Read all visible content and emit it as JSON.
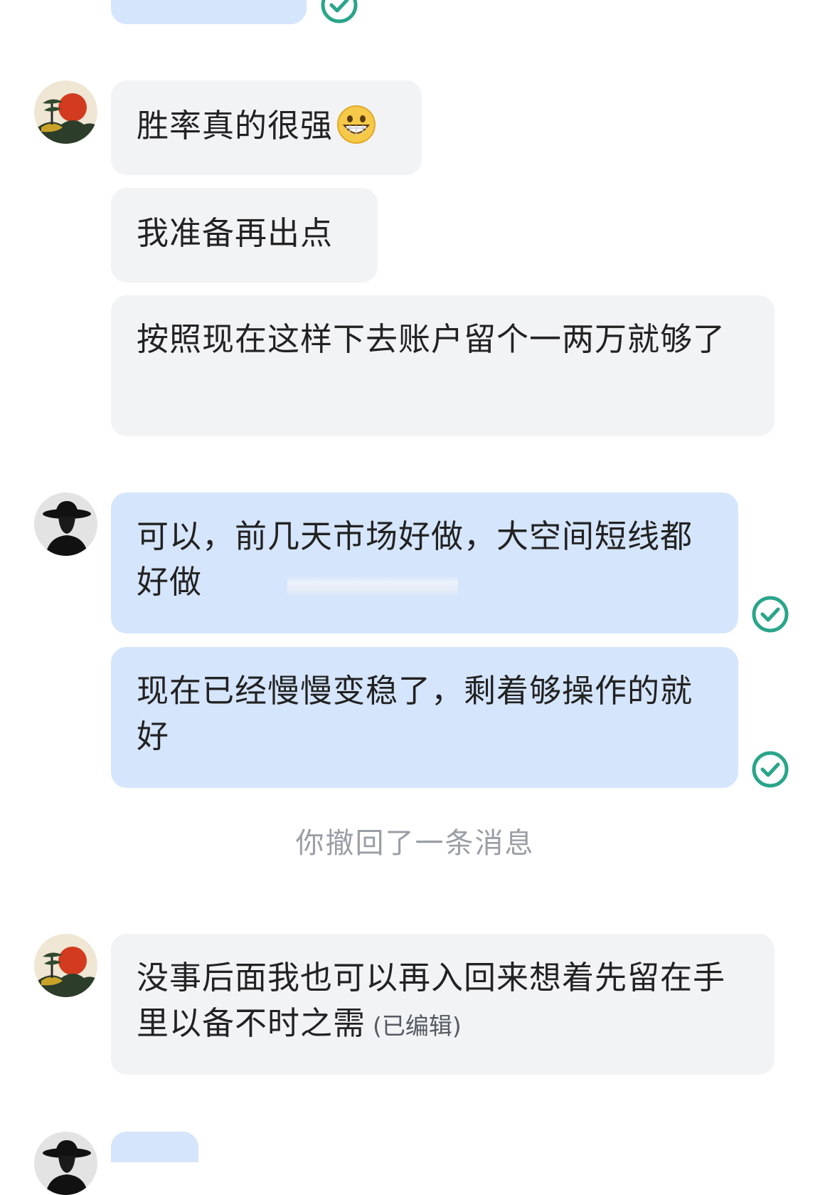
{
  "messages": [
    {
      "sender": "incoming",
      "text": "胜率真的很强",
      "emoji": "grinning-face"
    },
    {
      "sender": "incoming",
      "text": "我准备再出点"
    },
    {
      "sender": "incoming",
      "text": "按照现在这样下去账户留个一两万就够了"
    },
    {
      "sender": "outgoing",
      "text": "可以，前几天市场好做，大空间短线都好做",
      "status": "sent-check"
    },
    {
      "sender": "outgoing",
      "text": "现在已经慢慢变稳了，剩着够操作的就好",
      "status": "sent-check"
    },
    {
      "sender": "incoming",
      "text": "没事后面我也可以再入回来想着先留在手里以备不时之需",
      "edited_label": "(已编辑)"
    }
  ],
  "system": {
    "recall_notice": "你撤回了一条消息"
  },
  "colors": {
    "incoming_bubble": "#f2f3f5",
    "outgoing_bubble": "#d5e5fc",
    "check_green": "#2aa58a",
    "system_text": "#9a9ea5"
  },
  "icons": {
    "check": "check-circle-icon",
    "emoji": "grinning-face-icon"
  }
}
